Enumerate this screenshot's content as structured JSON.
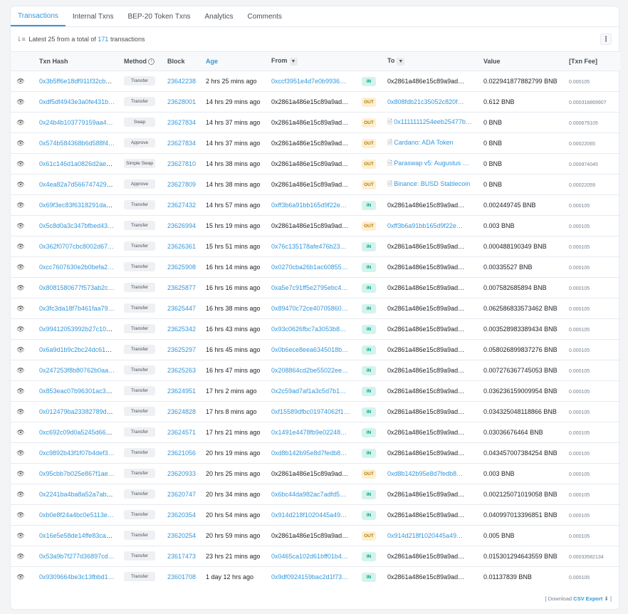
{
  "tabs": [
    {
      "label": "Transactions",
      "active": true
    },
    {
      "label": "Internal Txns",
      "active": false
    },
    {
      "label": "BEP-20 Token Txns",
      "active": false
    },
    {
      "label": "Analytics",
      "active": false
    },
    {
      "label": "Comments",
      "active": false
    }
  ],
  "summary": {
    "prefix": "Latest 25 from a total of",
    "count": "171",
    "suffix": "transactions"
  },
  "columns": {
    "hash": "Txn Hash",
    "method": "Method",
    "block": "Block",
    "age": "Age",
    "from": "From",
    "to": "To",
    "value": "Value",
    "fee": "[Txn Fee]"
  },
  "rows": [
    {
      "hash": "0x3b5ff6e18df911f32cb7…",
      "method": "Transfer",
      "block": "23642238",
      "age": "2 hrs 25 mins ago",
      "from": "0xccf3951e4d7e0b9936…",
      "dir": "IN",
      "to": "0x2861a486e15c89a9ad…",
      "value": "0.022941877882799 BNB",
      "fee": "0.000105"
    },
    {
      "hash": "0xdf5df4943e3a0fe431b…",
      "method": "Transfer",
      "block": "23628001",
      "age": "14 hrs 29 mins ago",
      "from": "0x2861a486e15c89a9ad…",
      "dir": "OUT",
      "to": "0x808fdb21c35052c820f…",
      "value": "0.612 BNB",
      "fee": "0.000318869907"
    },
    {
      "hash": "0x24b4b103779159aa4…",
      "method": "Swap",
      "block": "23627834",
      "age": "14 hrs 37 mins ago",
      "from": "0x2861a486e15c89a9ad…",
      "dir": "OUT",
      "to": "0x1111111254eeb25477b…",
      "value": "0 BNB",
      "fee": "0.000679105"
    },
    {
      "hash": "0x574b584368b6d588f4…",
      "method": "Approve",
      "block": "23627834",
      "age": "14 hrs 37 mins ago",
      "from": "0x2861a486e15c89a9ad…",
      "dir": "OUT",
      "to": "Cardano: ADA Token",
      "value": "0 BNB",
      "fee": "0.00022065"
    },
    {
      "hash": "0x61c146d1a0826d2ae5…",
      "method": "Simple Swap",
      "block": "23627810",
      "age": "14 hrs 38 mins ago",
      "from": "0x2861a486e15c89a9ad…",
      "dir": "OUT",
      "to": "Paraswap v5: Augustus …",
      "value": "0 BNB",
      "fee": "0.000974045"
    },
    {
      "hash": "0x4ea82a7d566747429c…",
      "method": "Approve",
      "block": "23627809",
      "age": "14 hrs 38 mins ago",
      "from": "0x2861a486e15c89a9ad…",
      "dir": "OUT",
      "to": "Binance: BUSD Stablecoin",
      "value": "0 BNB",
      "fee": "0.00022059"
    },
    {
      "hash": "0x69f3ec83f6318291daa…",
      "method": "Transfer",
      "block": "23627432",
      "age": "14 hrs 57 mins ago",
      "from": "0xff3b6a91bb165d9f22e…",
      "dir": "IN",
      "to": "0x2861a486e15c89a9ad…",
      "value": "0.002449745 BNB",
      "fee": "0.000105"
    },
    {
      "hash": "0x5c8d0a3c347bfbed43…",
      "method": "Transfer",
      "block": "23626994",
      "age": "15 hrs 19 mins ago",
      "from": "0x2861a486e15c89a9ad…",
      "dir": "OUT",
      "to": "0xff3b6a91bb165d9f22e…",
      "value": "0.003 BNB",
      "fee": "0.000105"
    },
    {
      "hash": "0x362f0707cbc8002d67…",
      "method": "Transfer",
      "block": "23626361",
      "age": "15 hrs 51 mins ago",
      "from": "0x76c135178afe476b23…",
      "dir": "IN",
      "to": "0x2861a486e15c89a9ad…",
      "value": "0.000488190349 BNB",
      "fee": "0.000105"
    },
    {
      "hash": "0xcc7607630e2b0befa2…",
      "method": "Transfer",
      "block": "23625908",
      "age": "16 hrs 14 mins ago",
      "from": "0x0270cba26b1ac60855…",
      "dir": "IN",
      "to": "0x2861a486e15c89a9ad…",
      "value": "0.00335527 BNB",
      "fee": "0.000105"
    },
    {
      "hash": "0x8081580677f573ab2c…",
      "method": "Transfer",
      "block": "23625877",
      "age": "16 hrs 16 mins ago",
      "from": "0xa5e7c91ff5e2795ebc4…",
      "dir": "IN",
      "to": "0x2861a486e15c89a9ad…",
      "value": "0.007582685894 BNB",
      "fee": "0.000105"
    },
    {
      "hash": "0x3fc3da18f7b461faa79…",
      "method": "Transfer",
      "block": "23625447",
      "age": "16 hrs 38 mins ago",
      "from": "0x89470c72ce40705860…",
      "dir": "IN",
      "to": "0x2861a486e15c89a9ad…",
      "value": "0.062586833573462 BNB",
      "fee": "0.000105"
    },
    {
      "hash": "0x99412053992b27c104…",
      "method": "Transfer",
      "block": "23625342",
      "age": "16 hrs 43 mins ago",
      "from": "0x93c0626fbc7a3053b8…",
      "dir": "IN",
      "to": "0x2861a486e15c89a9ad…",
      "value": "0.003528983389434 BNB",
      "fee": "0.000105"
    },
    {
      "hash": "0x6a9d1b9c2bc24dc612…",
      "method": "Transfer",
      "block": "23625297",
      "age": "16 hrs 45 mins ago",
      "from": "0x0b6ece8eea6345018b…",
      "dir": "IN",
      "to": "0x2861a486e15c89a9ad…",
      "value": "0.058026899837276 BNB",
      "fee": "0.000105"
    },
    {
      "hash": "0x247253f8b80762b0aa…",
      "method": "Transfer",
      "block": "23625263",
      "age": "16 hrs 47 mins ago",
      "from": "0x208864cd2be55022ee…",
      "dir": "IN",
      "to": "0x2861a486e15c89a9ad…",
      "value": "0.007276367745053 BNB",
      "fee": "0.000105"
    },
    {
      "hash": "0x853eac07b96301ac37…",
      "method": "Transfer",
      "block": "23624951",
      "age": "17 hrs 2 mins ago",
      "from": "0x2c59ad7af1a3c5d7b1…",
      "dir": "IN",
      "to": "0x2861a486e15c89a9ad…",
      "value": "0.036236159009954 BNB",
      "fee": "0.000105"
    },
    {
      "hash": "0x012479ba23382789d0…",
      "method": "Transfer",
      "block": "23624828",
      "age": "17 hrs 8 mins ago",
      "from": "0xf15589dfbc01974062f1…",
      "dir": "IN",
      "to": "0x2861a486e15c89a9ad…",
      "value": "0.034325048118866 BNB",
      "fee": "0.000105"
    },
    {
      "hash": "0xc692c09d0a5245d663…",
      "method": "Transfer",
      "block": "23624571",
      "age": "17 hrs 21 mins ago",
      "from": "0x1491e4478fb9e02248…",
      "dir": "IN",
      "to": "0x2861a486e15c89a9ad…",
      "value": "0.03036676464 BNB",
      "fee": "0.000105"
    },
    {
      "hash": "0xc9892b43f1f07b4def3…",
      "method": "Transfer",
      "block": "23621056",
      "age": "20 hrs 19 mins ago",
      "from": "0xd8b142b95e8d7fedb8…",
      "dir": "IN",
      "to": "0x2861a486e15c89a9ad…",
      "value": "0.043457007384254 BNB",
      "fee": "0.000105"
    },
    {
      "hash": "0x95cbb7b025e867f1ae…",
      "method": "Transfer",
      "block": "23620933",
      "age": "20 hrs 25 mins ago",
      "from": "0x2861a486e15c89a9ad…",
      "dir": "OUT",
      "to": "0xd8b142b95e8d7fedb8…",
      "value": "0.003 BNB",
      "fee": "0.000105"
    },
    {
      "hash": "0x2241ba4ba8a52a7ab5…",
      "method": "Transfer",
      "block": "23620747",
      "age": "20 hrs 34 mins ago",
      "from": "0x6bc44da982ac7adfd5…",
      "dir": "IN",
      "to": "0x2861a486e15c89a9ad…",
      "value": "0.002125071019058 BNB",
      "fee": "0.000105"
    },
    {
      "hash": "0xb0e8f24a4bc0e5113e…",
      "method": "Transfer",
      "block": "23620354",
      "age": "20 hrs 54 mins ago",
      "from": "0x914d218f1020445a49…",
      "dir": "IN",
      "to": "0x2861a486e15c89a9ad…",
      "value": "0.040997013396851 BNB",
      "fee": "0.000105"
    },
    {
      "hash": "0x16e5e58de14ffe83cae…",
      "method": "Transfer",
      "block": "23620254",
      "age": "20 hrs 59 mins ago",
      "from": "0x2861a486e15c89a9ad…",
      "dir": "OUT",
      "to": "0x914d218f1020445a49…",
      "value": "0.005 BNB",
      "fee": "0.000105"
    },
    {
      "hash": "0x53a9b7f277d36897cd…",
      "method": "Transfer",
      "block": "23617473",
      "age": "23 hrs 21 mins ago",
      "from": "0x0465ca102d61bff01b4…",
      "dir": "IN",
      "to": "0x2861a486e15c89a9ad…",
      "value": "0.015301294643559 BNB",
      "fee": "0.00033582134"
    },
    {
      "hash": "0x9309664be3c13fbbd1…",
      "method": "Transfer",
      "block": "23601708",
      "age": "1 day 12 hrs ago",
      "from": "0x9df0924159bac2d1f73…",
      "dir": "IN",
      "to": "0x2861a486e15c89a9ad…",
      "value": "0.01137839 BNB",
      "fee": "0.000105"
    }
  ],
  "footer": {
    "open": "[ Download",
    "csv": "CSV Export",
    "close": "]"
  }
}
